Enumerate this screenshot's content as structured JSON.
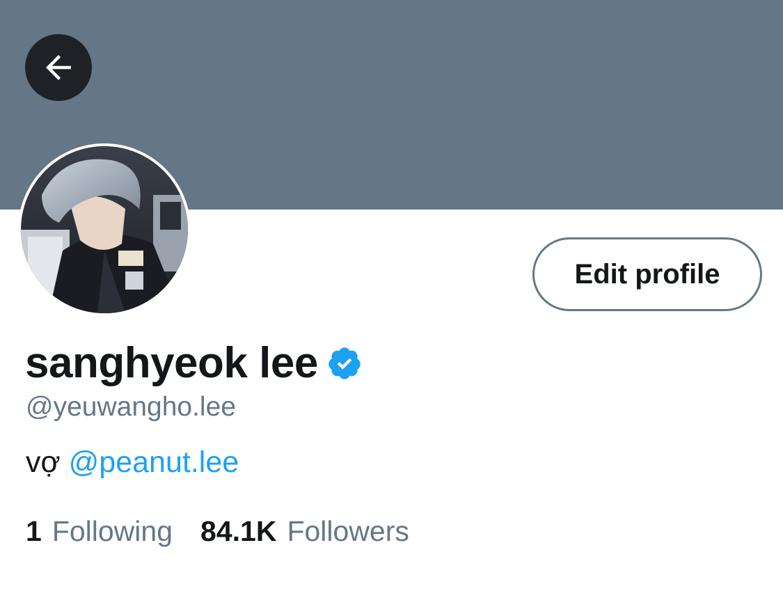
{
  "colors": {
    "banner": "#657786",
    "back_button": "#1e2226",
    "accent": "#1da1f2",
    "text_primary": "#14171a",
    "text_secondary": "#657786"
  },
  "header": {
    "back_icon": "arrow-left-icon"
  },
  "profile": {
    "avatar_icon": "profile-photo",
    "edit_button_label": "Edit profile",
    "display_name": "sanghyeok lee",
    "verified_icon": "verified-badge-icon",
    "handle": "@yeuwangho.lee",
    "bio_text": "vợ",
    "bio_mention": "@peanut.lee"
  },
  "stats": {
    "following_count": "1",
    "following_label": "Following",
    "followers_count": "84.1K",
    "followers_label": "Followers"
  }
}
